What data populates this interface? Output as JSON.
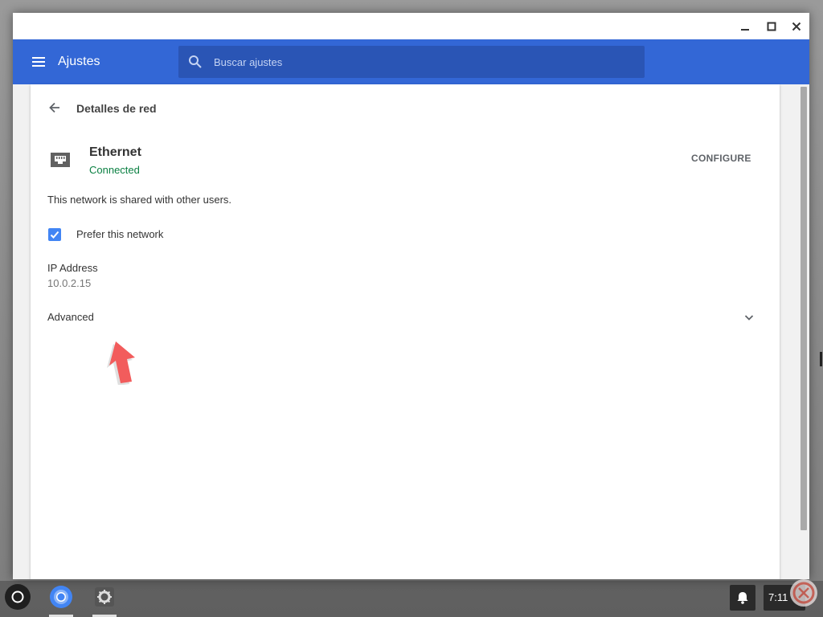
{
  "app": {
    "title": "Ajustes"
  },
  "search": {
    "placeholder": "Buscar ajustes"
  },
  "window_controls": {
    "minimize_icon": "minimize-icon",
    "maximize_icon": "maximize-icon",
    "close_icon": "close-icon"
  },
  "subpage": {
    "title": "Detalles de red"
  },
  "network": {
    "name": "Ethernet",
    "status": "Connected",
    "configure_label": "CONFIGURE",
    "shared_text": "This network is shared with other users.",
    "prefer_label": "Prefer this network",
    "prefer_checked": true,
    "ip_label": "IP Address",
    "ip_value": "10.0.2.15",
    "advanced_label": "Advanced"
  },
  "shelf": {
    "time": "7:11"
  },
  "colors": {
    "appbar": "#3367d6",
    "search_bg": "#2a55b5",
    "connected": "#0b8043",
    "checkbox": "#4285f4",
    "annotation_arrow": "#f25c5c"
  }
}
